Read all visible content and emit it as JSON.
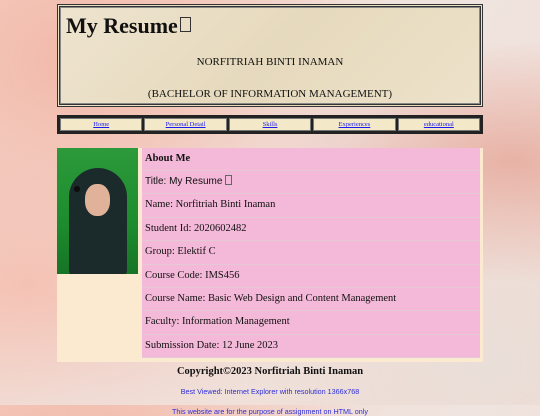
{
  "header": {
    "title": "My Resume",
    "name": "NORFITRIAH BINTI INAMAN",
    "degree": "(BACHELOR OF INFORMATION MANAGEMENT)"
  },
  "nav": {
    "items": [
      "Home",
      "Personal Detail",
      "Skills",
      "Experiences",
      "educational"
    ]
  },
  "about": {
    "heading": "About Me",
    "title": "Title: My Resume",
    "name": "Name: Norfitriah Binti Inaman",
    "student_id": "Student Id: 2020602482",
    "group": "Group: Elektif C",
    "course_code": "Course Code: IMS456",
    "course_name": "Course Name: Basic Web Design and Content Management",
    "faculty": "Faculty: Information Management",
    "submission": "Submission Date: 12 June 2023"
  },
  "footer": {
    "copyright": "Copyright©2023 Norfitriah Binti Inaman",
    "best_viewed": "Best Viewed: Internet Explorer with resolution 1366x768",
    "purpose": "This website are for the purpose of assignment on HTML only"
  },
  "colors": {
    "link": "#1a1aee",
    "info_panel": "#f4b8d8",
    "content_bg": "#fbeacf",
    "footer_text": "#2d2dd8"
  }
}
